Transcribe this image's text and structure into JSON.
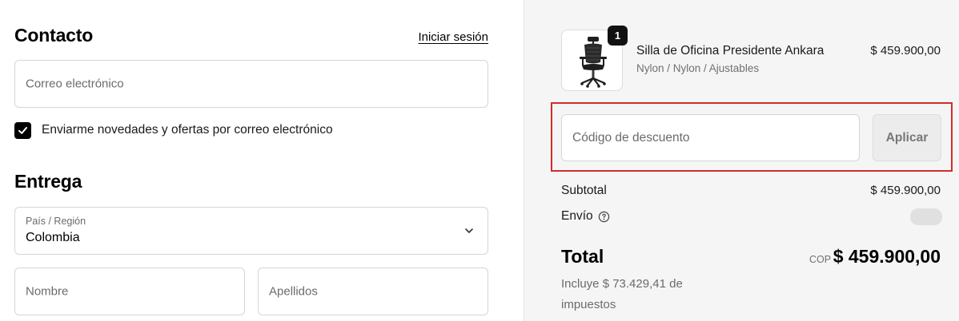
{
  "contact": {
    "title": "Contacto",
    "login_link": "Iniciar sesión",
    "email_placeholder": "Correo electrónico",
    "newsletter_label": "Enviarme novedades y ofertas por correo electrónico",
    "newsletter_checked": true
  },
  "delivery": {
    "title": "Entrega",
    "country_label": "País / Región",
    "country_value": "Colombia",
    "first_name_placeholder": "Nombre",
    "last_name_placeholder": "Apellidos"
  },
  "order": {
    "item": {
      "quantity": "1",
      "name": "Silla de Oficina Presidente Ankara",
      "variant": "Nylon / Nylon / Ajustables",
      "price": "$ 459.900,00",
      "image_icon": "office-chair-icon"
    },
    "discount": {
      "placeholder": "Código de descuento",
      "apply_label": "Aplicar"
    },
    "subtotal_label": "Subtotal",
    "subtotal_value": "$ 459.900,00",
    "shipping_label": "Envío",
    "total_label": "Total",
    "total_currency": "COP",
    "total_value": "$ 459.900,00",
    "tax_note": "Incluye $ 73.429,41 de impuestos"
  },
  "colors": {
    "highlight": "#d22b2b",
    "summary_background": "#f5f5f5"
  }
}
